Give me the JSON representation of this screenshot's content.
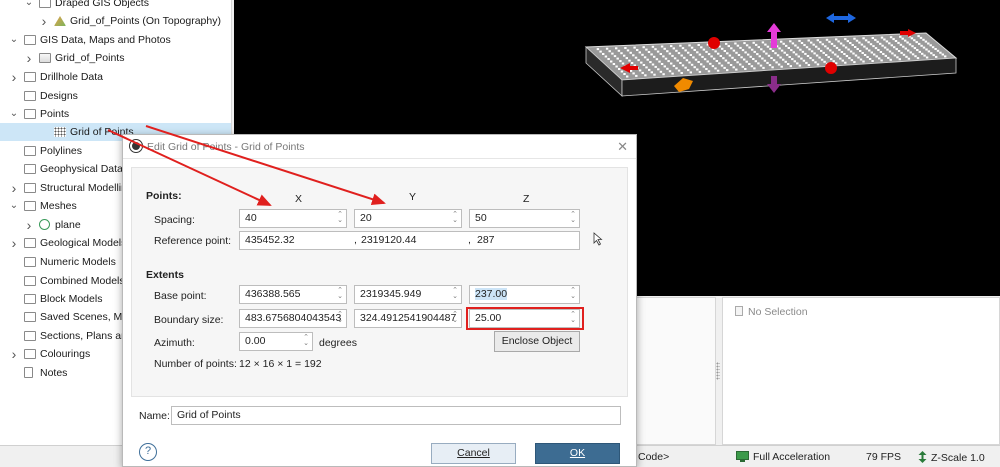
{
  "tree": {
    "items": [
      {
        "label": "Draped GIS Objects",
        "indent": 2,
        "chevron": "down",
        "icon": "folder"
      },
      {
        "label": "Grid_of_Points (On Topography)",
        "indent": 3,
        "chevron": "right",
        "icon": "topo"
      },
      {
        "label": "GIS Data, Maps and Photos",
        "indent": 1,
        "chevron": "down",
        "icon": "folder"
      },
      {
        "label": "Grid_of_Points",
        "indent": 2,
        "chevron": "right",
        "icon": "map"
      },
      {
        "label": "Drillhole Data",
        "indent": 1,
        "chevron": "right",
        "icon": "folder"
      },
      {
        "label": "Designs",
        "indent": 1,
        "chevron": "",
        "icon": "folder"
      },
      {
        "label": "Points",
        "indent": 1,
        "chevron": "down",
        "icon": "folder"
      },
      {
        "label": "Grid of Points",
        "indent": 3,
        "chevron": "",
        "icon": "grid",
        "selected": true
      },
      {
        "label": "Polylines",
        "indent": 1,
        "chevron": "",
        "icon": "folder"
      },
      {
        "label": "Geophysical Data",
        "indent": 1,
        "chevron": "",
        "icon": "folder"
      },
      {
        "label": "Structural Modelling",
        "indent": 1,
        "chevron": "right",
        "icon": "folder"
      },
      {
        "label": "Meshes",
        "indent": 1,
        "chevron": "down",
        "icon": "folder"
      },
      {
        "label": "plane",
        "indent": 2,
        "chevron": "right",
        "icon": "mesh"
      },
      {
        "label": "Geological Models",
        "indent": 1,
        "chevron": "right",
        "icon": "folder"
      },
      {
        "label": "Numeric Models",
        "indent": 1,
        "chevron": "",
        "icon": "folder"
      },
      {
        "label": "Combined Models",
        "indent": 1,
        "chevron": "",
        "icon": "folder"
      },
      {
        "label": "Block Models",
        "indent": 1,
        "chevron": "",
        "icon": "folder"
      },
      {
        "label": "Saved Scenes, Movi",
        "indent": 1,
        "chevron": "",
        "icon": "folder"
      },
      {
        "label": "Sections, Plans and",
        "indent": 1,
        "chevron": "",
        "icon": "folder"
      },
      {
        "label": "Colourings",
        "indent": 1,
        "chevron": "right",
        "icon": "folder"
      },
      {
        "label": "Notes",
        "indent": 1,
        "chevron": "",
        "icon": "doc"
      }
    ]
  },
  "selection_panel": {
    "text": "No Selection"
  },
  "statusbar": {
    "code_text": "Code>",
    "acceleration": "Full Acceleration",
    "fps": "79 FPS",
    "zscale": "Z-Scale 1.0"
  },
  "dialog": {
    "title": "Edit Grid of Points - Grid of Points",
    "points_heading": "Points:",
    "col_x": "X",
    "col_y": "Y",
    "col_z": "Z",
    "spacing_label": "Spacing:",
    "spacing": {
      "x": "40",
      "y": "20",
      "z": "50"
    },
    "reference_label": "Reference point:",
    "reference": {
      "x": "435452.32",
      "sep1": ",",
      "y": "2319120.44",
      "sep2": ",",
      "z": "287"
    },
    "extents_heading": "Extents",
    "base_label": "Base point:",
    "base": {
      "x": "436388.565",
      "y": "2319345.949",
      "z": "237.00"
    },
    "boundary_label": "Boundary size:",
    "boundary": {
      "x": "483.6756804043543",
      "y": "324.4912541904487",
      "z": "25.00"
    },
    "azimuth_label": "Azimuth:",
    "azimuth_value": "0.00",
    "azimuth_unit": "degrees",
    "enclose_button": "Enclose Object",
    "npoints_label": "Number of points:",
    "npoints_value": "12 × 16 × 1 = 192",
    "name_label": "Name:",
    "name_value": "Grid of Points",
    "help": "?",
    "cancel": "Cancel",
    "ok": "OK"
  },
  "colors": {
    "accent": "#3d6c92",
    "selection": "#cde6f7",
    "annotation_red": "#e0201e",
    "viewport_bg": "#000000"
  }
}
